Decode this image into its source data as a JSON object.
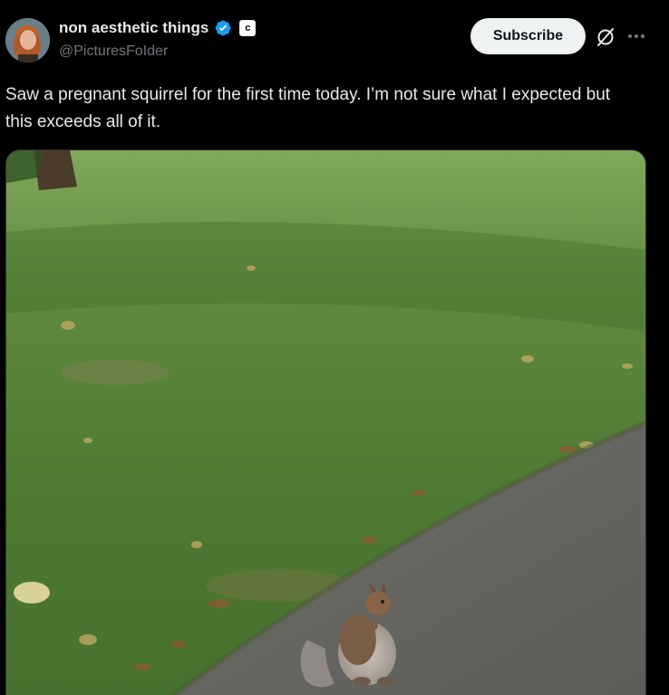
{
  "author": {
    "display_name": "non aesthetic things",
    "handle": "@PicturesFoIder",
    "avatar_icon": "avatar-portrait",
    "verified_color": "#1d9bf0",
    "affiliate_badge": "c"
  },
  "actions": {
    "subscribe_label": "Subscribe",
    "grok_icon": "grok-icon",
    "more_icon": "more-icon"
  },
  "tweet": {
    "text": "Saw a pregnant squirrel for the first time today. I’m not sure what I expected but this exceeds all of it."
  },
  "media": {
    "icon": "photo-squirrel-on-path"
  }
}
